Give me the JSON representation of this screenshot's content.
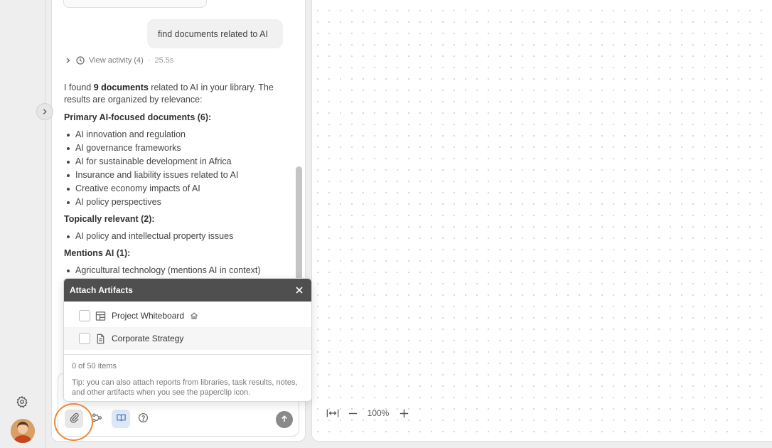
{
  "chat": {
    "user_message": "find documents related to AI",
    "activity": {
      "label": "View activity (4)",
      "separator": "·",
      "duration": "25.5s"
    },
    "answer": {
      "intro_pre": "I found ",
      "intro_bold": "9 documents",
      "intro_post": " related to AI in your library. The results are organized by relevance:",
      "sections": [
        {
          "heading": "Primary AI-focused documents (6):",
          "items": [
            "AI innovation and regulation",
            "AI governance frameworks",
            "AI for sustainable development in Africa",
            "Insurance and liability issues related to AI",
            "Creative economy impacts of AI",
            "AI policy perspectives"
          ]
        },
        {
          "heading": "Topically relevant (2):",
          "items": [
            "AI policy and intellectual property issues"
          ]
        },
        {
          "heading": "Mentions AI (1):",
          "items": [
            "Agricultural technology (mentions AI in context)"
          ]
        }
      ]
    }
  },
  "popup": {
    "title": "Attach Artifacts",
    "artifacts": [
      {
        "name": "Project Whiteboard",
        "icon": "whiteboard-icon",
        "badge_icon": "home-icon"
      },
      {
        "name": "Corporate Strategy",
        "icon": "document-icon"
      }
    ],
    "count_text": "0 of 50 items",
    "tip": "Tip: you can also attach reports from libraries, task results, notes, and other artifacts when you see the paperclip icon."
  },
  "composer": {
    "tools": [
      "paperclip-icon",
      "workflow-icon",
      "library-icon",
      "help-icon"
    ],
    "send_icon": "arrow-up-icon"
  },
  "canvas": {
    "zoom_level": "100%"
  },
  "colors": {
    "popup_header": "#4f4f4f",
    "highlight_ring": "#e9893b",
    "library_tool_bg": "#dde8f7"
  }
}
